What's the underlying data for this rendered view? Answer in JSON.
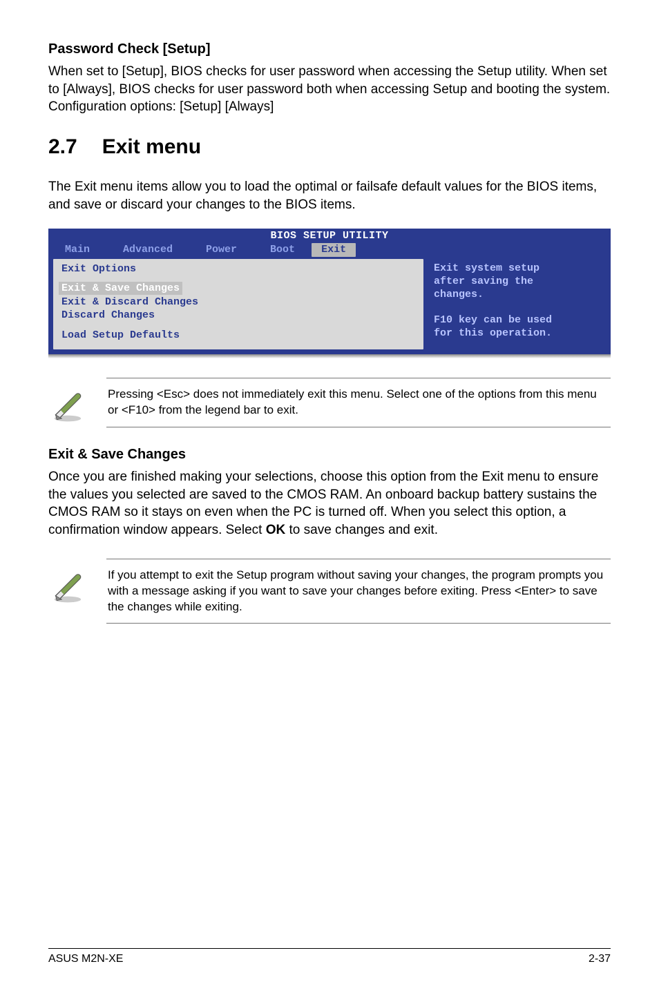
{
  "password_section": {
    "heading": "Password Check [Setup]",
    "para": "When set to [Setup], BIOS checks for user password when accessing the Setup utility. When set to [Always], BIOS checks for user password both when accessing Setup and booting the system. Configuration options: [Setup] [Always]"
  },
  "exit_section": {
    "number": "2.7",
    "title": "Exit menu",
    "intro": "The Exit menu items allow you to load the optimal or failsafe default values for the BIOS items, and save or discard your changes to the BIOS items."
  },
  "bios": {
    "title": "BIOS SETUP UTILITY",
    "tabs": [
      "Main",
      "Advanced",
      "Power",
      "Boot",
      "Exit"
    ],
    "active_tab_index": 4,
    "left": {
      "header": "Exit Options",
      "items": [
        {
          "label": "Exit & Save Changes",
          "selected": true
        },
        {
          "label": "Exit & Discard Changes",
          "selected": false
        },
        {
          "label": "Discard Changes",
          "selected": false
        }
      ],
      "last_item": "Load Setup Defaults"
    },
    "right_lines": [
      "Exit system setup",
      "after saving the",
      "changes.",
      "",
      "F10 key can be used",
      "for this operation."
    ]
  },
  "note1": "Pressing <Esc> does not immediately exit this menu. Select one of the options from this menu or <F10> from the legend bar to exit.",
  "save_section": {
    "heading": "Exit & Save Changes",
    "para_pre": "Once you are finished making your selections, choose this option from the Exit menu to ensure the values you selected are saved to the CMOS RAM. An onboard backup battery sustains the CMOS RAM so it stays on even when the PC is turned off. When you select this option, a confirmation window appears. Select ",
    "para_bold": "OK",
    "para_post": " to save changes and exit."
  },
  "note2": " If you attempt to exit the Setup program without saving your changes, the program prompts you with a message asking if you want to save your changes before exiting. Press <Enter>  to save the  changes while exiting.",
  "footer": {
    "left": "ASUS M2N-XE",
    "right": "2-37"
  }
}
